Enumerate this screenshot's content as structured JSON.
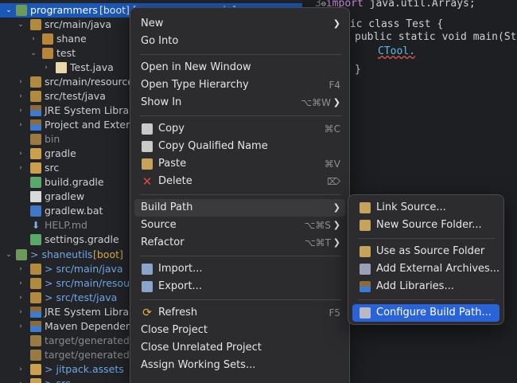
{
  "tree": {
    "rows": [
      {
        "label": "programmers",
        "decor": "[boot] [programmers main]"
      },
      {
        "label": "src/main/java"
      },
      {
        "label": "shane"
      },
      {
        "label": "test"
      },
      {
        "label": "Test.java"
      },
      {
        "label": "src/main/resources"
      },
      {
        "label": "src/test/java"
      },
      {
        "label": "JRE System Library"
      },
      {
        "label": "Project and External Dependencies"
      },
      {
        "label": "bin"
      },
      {
        "label": "gradle"
      },
      {
        "label": "src"
      },
      {
        "label": "build.gradle"
      },
      {
        "label": "gradlew"
      },
      {
        "label": "gradlew.bat"
      },
      {
        "label": "HELP.md"
      },
      {
        "label": "settings.gradle"
      },
      {
        "label": "> shaneutils",
        "decor": "[boot]"
      },
      {
        "label": "> src/main/java"
      },
      {
        "label": "> src/main/resources"
      },
      {
        "label": "> src/test/java"
      },
      {
        "label": "JRE System Library"
      },
      {
        "label": "Maven Dependencies"
      },
      {
        "label": "target/generated-sources"
      },
      {
        "label": "target/generated-test-sources"
      },
      {
        "label": "> jitpack.assets"
      },
      {
        "label": "> src"
      }
    ]
  },
  "editor": {
    "line3_num": "3",
    "import_kw": "import",
    "import_rest": " java.util.Arrays;",
    "class_decl": ".ic class Test {",
    "method_decl": "public static void main(Strin",
    "call": "CTool.",
    "close_brace": "}"
  },
  "context_menu": {
    "items": [
      {
        "label": "New"
      },
      {
        "label": "Go Into"
      },
      {
        "label": "Open in New Window"
      },
      {
        "label": "Open Type Hierarchy",
        "shortcut": "F4"
      },
      {
        "label": "Show In",
        "shortcut": "⌥⌘W"
      },
      {
        "label": "Copy",
        "shortcut": "⌘C",
        "icon": "copy-icon"
      },
      {
        "label": "Copy Qualified Name",
        "icon": "copy-qualified-name-icon"
      },
      {
        "label": "Paste",
        "shortcut": "⌘V",
        "icon": "paste-icon"
      },
      {
        "label": "Delete",
        "shortcut": "⌦",
        "icon": "delete-icon"
      },
      {
        "label": "Build Path"
      },
      {
        "label": "Source",
        "shortcut": "⌥⌘S"
      },
      {
        "label": "Refactor",
        "shortcut": "⌥⌘T"
      },
      {
        "label": "Import...",
        "icon": "import-icon"
      },
      {
        "label": "Export...",
        "icon": "export-icon"
      },
      {
        "label": "Refresh",
        "shortcut": "F5",
        "icon": "refresh-icon"
      },
      {
        "label": "Close Project"
      },
      {
        "label": "Close Unrelated Project"
      },
      {
        "label": "Assign Working Sets..."
      }
    ]
  },
  "build_path_menu": {
    "items": [
      {
        "label": "Link Source..."
      },
      {
        "label": "New Source Folder..."
      },
      {
        "label": "Use as Source Folder"
      },
      {
        "label": "Add External Archives..."
      },
      {
        "label": "Add Libraries..."
      },
      {
        "label": "Configure Build Path..."
      }
    ]
  },
  "colors": {
    "selection": "#1b57b5",
    "menu_highlight": "#2a62d8",
    "menu_bg": "#2c2c2e",
    "editor_bg": "#1e1f22"
  }
}
